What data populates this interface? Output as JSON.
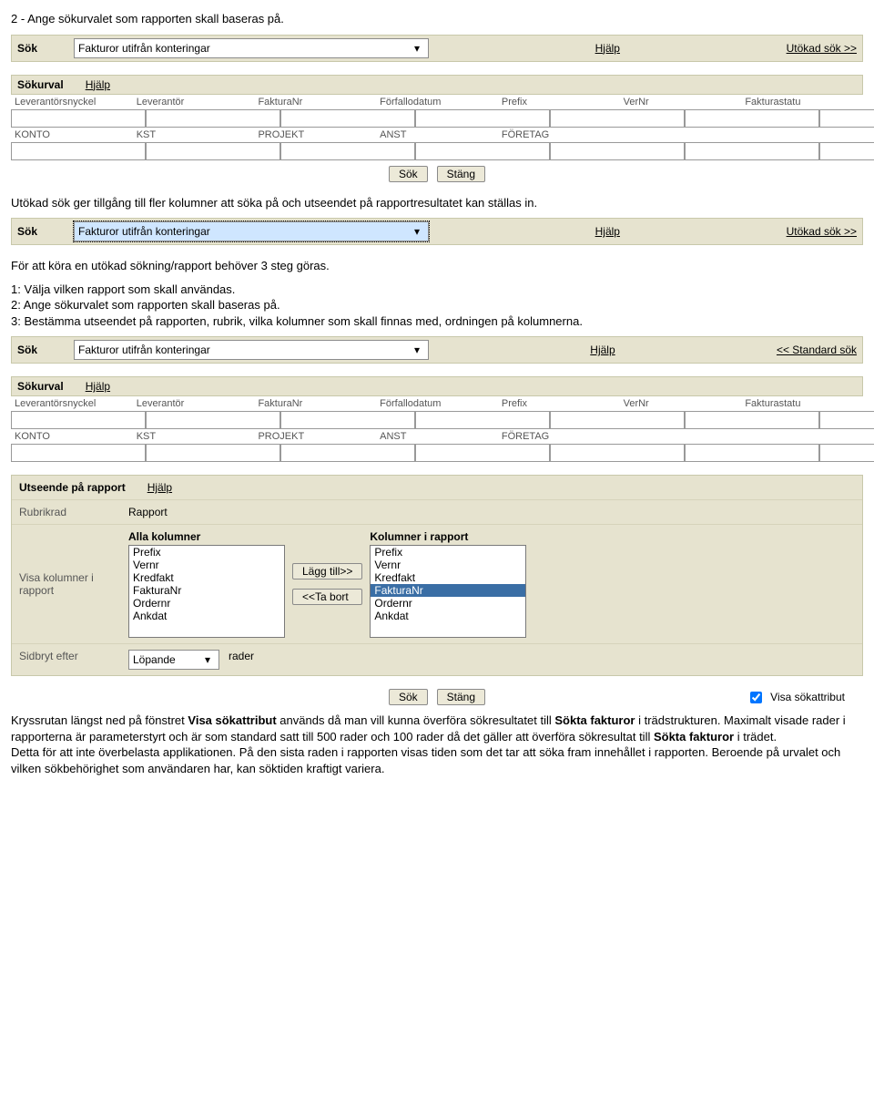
{
  "text": {
    "intro": "2 - Ange sökurvalet som rapporten skall baseras på.",
    "p2": "Utökad sök ger tillgång till fler kolumner att söka på och utseendet på rapportresultatet kan ställas in.",
    "p3": "För att köra en utökad sökning/rapport behöver 3 steg göras.",
    "p4": "1: Välja vilken rapport som skall användas.\n2: Ange sökurvalet som rapporten skall baseras på.\n3: Bestämma utseendet på rapporten, rubrik, vilka kolumner som skall finnas med, ordningen på kolumnerna.",
    "p5a": "Kryssrutan längst ned på fönstret ",
    "p5b": " används då man vill kunna överföra sökresultatet till ",
    "p5c": " i trädstrukturen. Maximalt visade rader i rapporterna är parameterstyrt och är som standard satt till 500 rader och 100 rader då det gäller att överföra sökresultat till ",
    "p5d": " i trädet.",
    "p5e": "Detta för att inte överbelasta applikationen. På den sista raden i rapporten visas tiden som det tar att söka fram innehållet i rapporten. Beroende på urvalet och vilken sökbehörighet som användaren har, kan söktiden kraftigt variera.",
    "bold_visa": "Visa sökattribut",
    "bold_sokta": "Sökta fakturor",
    "bold_sokta2": "Sökta fakturor"
  },
  "sok": {
    "label": "Sök",
    "value": "Fakturor utifrån konteringar",
    "help": "Hjälp",
    "utokad": "Utökad sök >>",
    "standard": "<< Standard sök"
  },
  "sokurval": {
    "label": "Sökurval",
    "help": "Hjälp",
    "headers": [
      "Leverantörsnyckel",
      "Leverantör",
      "FakturaNr",
      "Förfallodatum",
      "Prefix",
      "VerNr",
      "Fakturastatu"
    ],
    "headers2": [
      "KONTO",
      "KST",
      "PROJEKT",
      "ANST",
      "FÖRETAG"
    ]
  },
  "buttons": {
    "sok": "Sök",
    "stang": "Stäng",
    "lagg": "Lägg till>>",
    "tabort": "<<Ta bort"
  },
  "utseende": {
    "title": "Utseende på rapport",
    "help": "Hjälp",
    "rubrik": "Rubrikrad",
    "rapport": "Rapport",
    "visa": "Visa kolumner i rapport",
    "alla": "Alla kolumner",
    "irapport": "Kolumner i rapport",
    "items_all": [
      "Prefix",
      "Vernr",
      "Kredfakt",
      "FakturaNr",
      "Ordernr",
      "Ankdat"
    ],
    "items_rpt": [
      "Prefix",
      "Vernr",
      "Kredfakt",
      "FakturaNr",
      "Ordernr",
      "Ankdat"
    ],
    "selected": "FakturaNr",
    "sidbryt": "Sidbryt efter",
    "lopande": "Löpande",
    "rader": "rader",
    "visaattr": "Visa sökattribut"
  }
}
